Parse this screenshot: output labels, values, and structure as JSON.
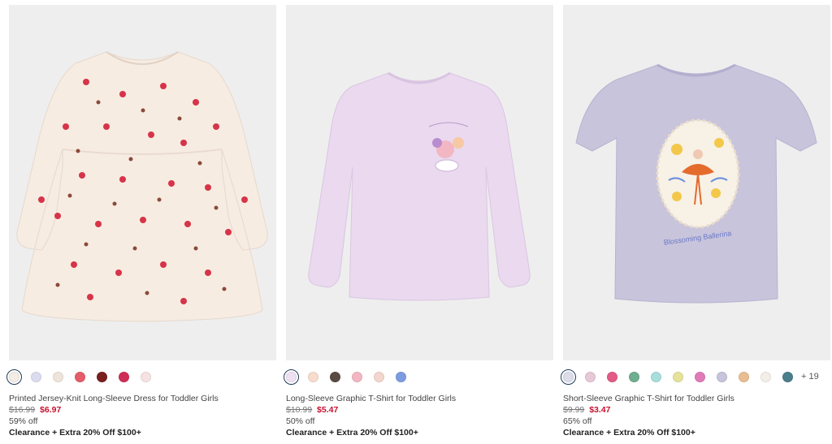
{
  "products": [
    {
      "name": "Printed Jersey-Knit Long-Sleeve Dress for Toddler Girls",
      "original_price": "$16.99",
      "sale_price": "$6.97",
      "discount": "59% off",
      "promo": "Clearance + Extra 20% Off $100+",
      "garment_color": "#f7ece2",
      "swatches": [
        {
          "color": "#f4ede6",
          "selected": true
        },
        {
          "color": "#dcdcef",
          "selected": false
        },
        {
          "color": "#efe4da",
          "selected": false
        },
        {
          "color": "#e45d6b",
          "selected": false
        },
        {
          "color": "#7a1f1f",
          "selected": false
        },
        {
          "color": "#cf2d56",
          "selected": false
        },
        {
          "color": "#f6e2e2",
          "selected": false
        }
      ],
      "more_colors": ""
    },
    {
      "name": "Long-Sleeve Graphic T-Shirt for Toddler Girls",
      "original_price": "$10.99",
      "sale_price": "$5.47",
      "discount": "50% off",
      "promo": "Clearance + Extra 20% Off $100+",
      "garment_color": "#ead9ef",
      "swatches": [
        {
          "color": "#efe0f2",
          "selected": true
        },
        {
          "color": "#f7dccd",
          "selected": false
        },
        {
          "color": "#5a4a42",
          "selected": false
        },
        {
          "color": "#f2b7c3",
          "selected": false
        },
        {
          "color": "#f3d7cf",
          "selected": false
        },
        {
          "color": "#7d9be0",
          "selected": false
        }
      ],
      "more_colors": ""
    },
    {
      "name": "Short-Sleeve Graphic T-Shirt for Toddler Girls",
      "original_price": "$9.99",
      "sale_price": "$3.47",
      "discount": "65% off",
      "promo": "Clearance + Extra 20% Off $100+",
      "garment_color": "#c8c4dc",
      "print_text": "Blossoming Ballerina",
      "swatches": [
        {
          "color": "#dcdcea",
          "selected": true
        },
        {
          "color": "#e6c8d6",
          "selected": false
        },
        {
          "color": "#e45a86",
          "selected": false
        },
        {
          "color": "#6fae8e",
          "selected": false
        },
        {
          "color": "#a7dedc",
          "selected": false
        },
        {
          "color": "#e6e29a",
          "selected": false
        },
        {
          "color": "#e07bb8",
          "selected": false
        },
        {
          "color": "#c8c4dc",
          "selected": false
        },
        {
          "color": "#e9bd92",
          "selected": false
        },
        {
          "color": "#f3efe8",
          "selected": false
        },
        {
          "color": "#4a7e8a",
          "selected": false
        }
      ],
      "more_colors": "+ 19"
    }
  ]
}
